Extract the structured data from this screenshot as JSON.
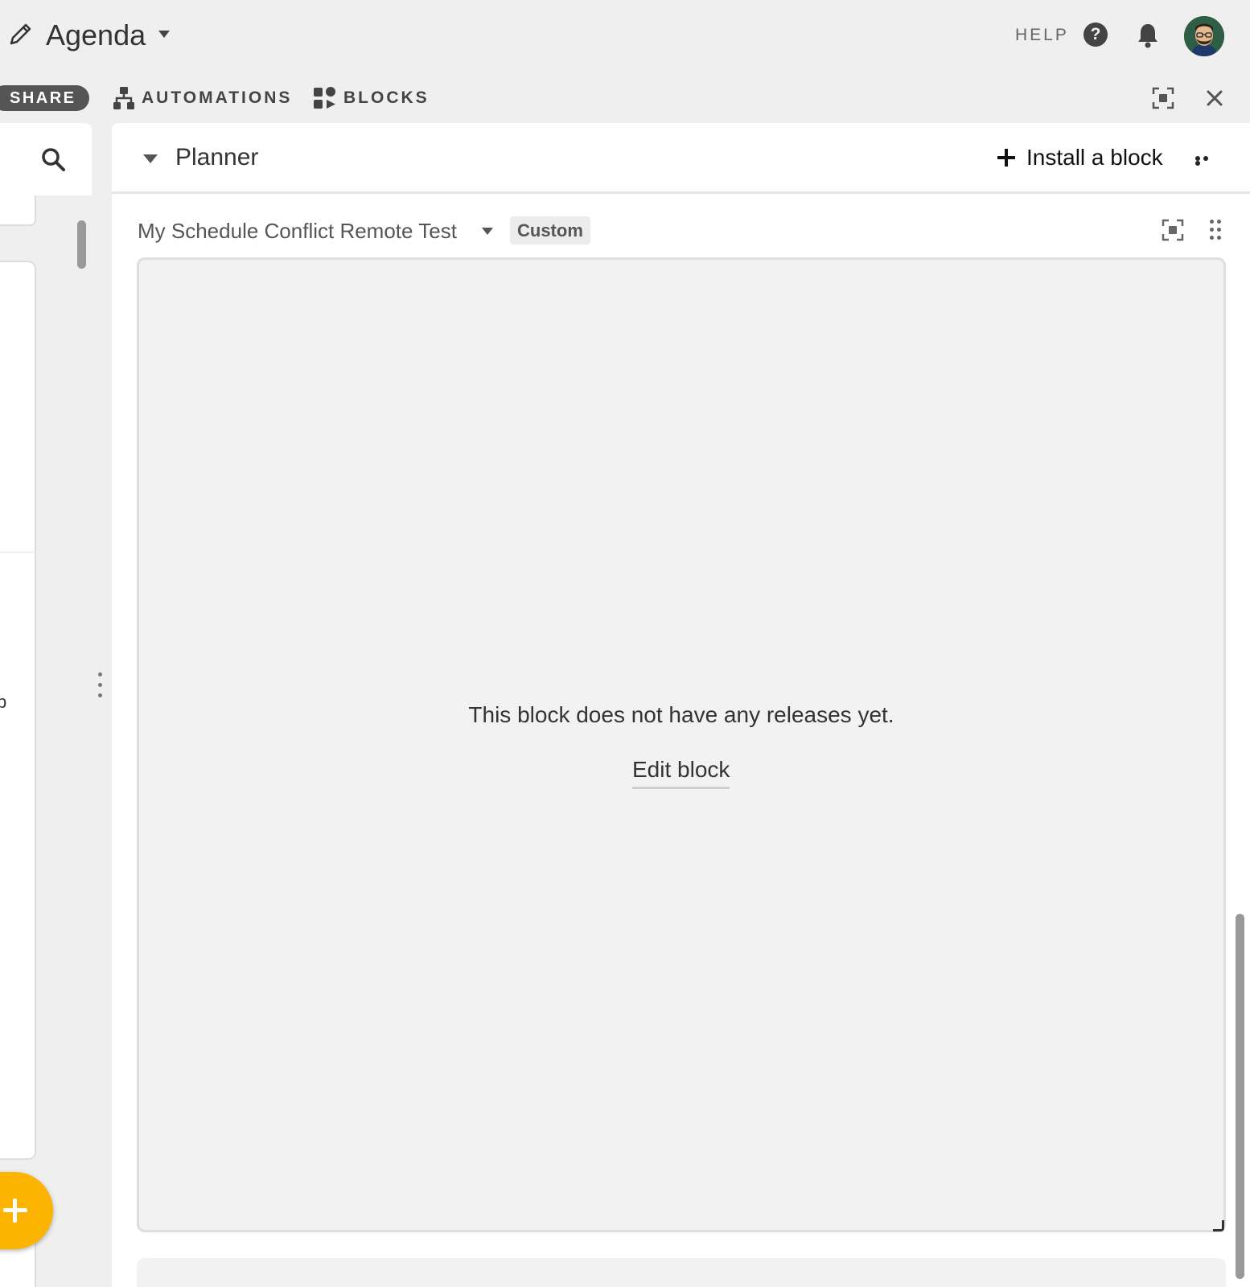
{
  "topbar": {
    "base_name": "Agenda",
    "help_label": "HELP",
    "help_glyph": "?"
  },
  "toolbar": {
    "share_label": "SHARE",
    "automations_label": "AUTOMATIONS",
    "blocks_label": "BLOCKS"
  },
  "sidebar": {
    "partial_glyph": "p"
  },
  "panel": {
    "title": "Planner",
    "install_label": "Install a block"
  },
  "block": {
    "name": "My Schedule Conflict Remote Test",
    "badge": "Custom",
    "empty_message": "This block does not have any releases yet.",
    "edit_label": "Edit block"
  },
  "colors": {
    "accent_fab": "#fcb400",
    "share_pill": "#555555",
    "background": "#efefef"
  },
  "icons": [
    "pencil-icon",
    "chevron-down-icon",
    "help-icon",
    "bell-icon",
    "avatar",
    "automations-icon",
    "blocks-icon",
    "expand-icon",
    "close-icon",
    "search-icon",
    "plus-icon",
    "more-icon",
    "drag-handle-icon"
  ]
}
